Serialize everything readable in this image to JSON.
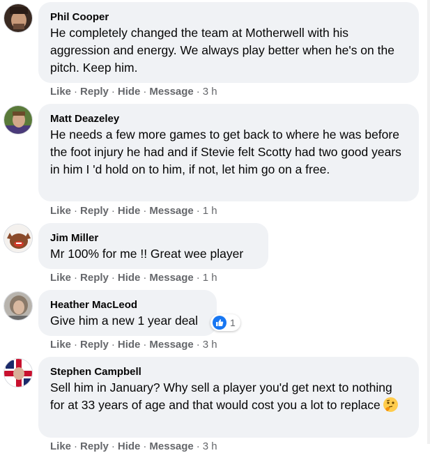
{
  "comments": [
    {
      "author": "Phil Cooper",
      "text": "He completely changed the team at Motherwell with his aggression and energy. We always play better when he's on the pitch. Keep him.",
      "time": "3 h"
    },
    {
      "author": "Matt Deazeley",
      "text": "He needs a few more games to get back to where he was before the foot injury he had and if Stevie felt Scotty had two good years in him I 'd hold on to him, if not, let him go on a free.",
      "time": "1 h"
    },
    {
      "author": "Jim Miller",
      "text": "Mr 100% for me !! Great wee player",
      "time": "1 h"
    },
    {
      "author": "Heather MacLeod",
      "text": "Give him a new 1 year deal",
      "time": "3 h",
      "reaction": {
        "icon": "thumbs-up-icon",
        "count": "1"
      }
    },
    {
      "author": "Stephen Campbell",
      "text": "Sell him in January? Why sell a player you'd get next to nothing for at 33 years of age and that would cost you a lot to replace",
      "emoji": "thinking-face-emoji",
      "time": "3 h"
    }
  ],
  "actions": {
    "like": "Like",
    "reply": "Reply",
    "hide": "Hide",
    "message": "Message",
    "separator": "·"
  },
  "colors": {
    "bubble": "#f0f2f5",
    "action_text": "#65676b",
    "reaction_blue": "#1877f2"
  }
}
